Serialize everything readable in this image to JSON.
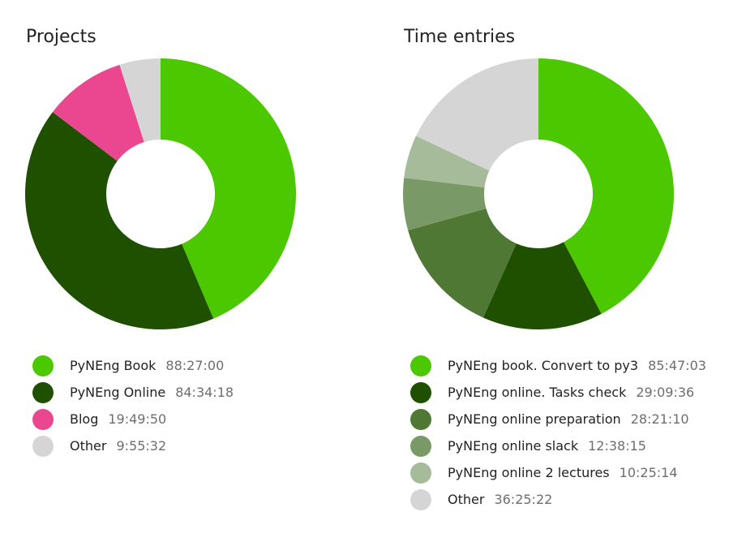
{
  "chart_data": [
    {
      "type": "pie",
      "title": "Projects",
      "slices": [
        {
          "label": "PyNEng Book",
          "duration": "88:27:00",
          "hours": 88.45,
          "color": "#4bc800"
        },
        {
          "label": "PyNEng Online",
          "duration": "84:34:18",
          "hours": 84.572,
          "color": "#1e5000"
        },
        {
          "label": "Blog",
          "duration": "19:49:50",
          "hours": 19.831,
          "color": "#eb4791"
        },
        {
          "label": "Other",
          "duration": "9:55:32",
          "hours": 9.926,
          "color": "#d5d5d5"
        }
      ]
    },
    {
      "type": "pie",
      "title": "Time entries",
      "slices": [
        {
          "label": "PyNEng book. Convert to py3",
          "duration": "85:47:03",
          "hours": 85.784,
          "color": "#4bc800"
        },
        {
          "label": "PyNEng online. Tasks check",
          "duration": "29:09:36",
          "hours": 29.16,
          "color": "#1e5000"
        },
        {
          "label": "PyNEng online preparation",
          "duration": "28:21:10",
          "hours": 28.353,
          "color": "#4e7834"
        },
        {
          "label": "PyNEng online slack",
          "duration": "12:38:15",
          "hours": 12.638,
          "color": "#799966"
        },
        {
          "label": "PyNEng online 2 lectures",
          "duration": "10:25:14",
          "hours": 10.421,
          "color": "#a5bb99"
        },
        {
          "label": "Other",
          "duration": "36:25:22",
          "hours": 36.423,
          "color": "#d5d5d5"
        }
      ]
    }
  ]
}
